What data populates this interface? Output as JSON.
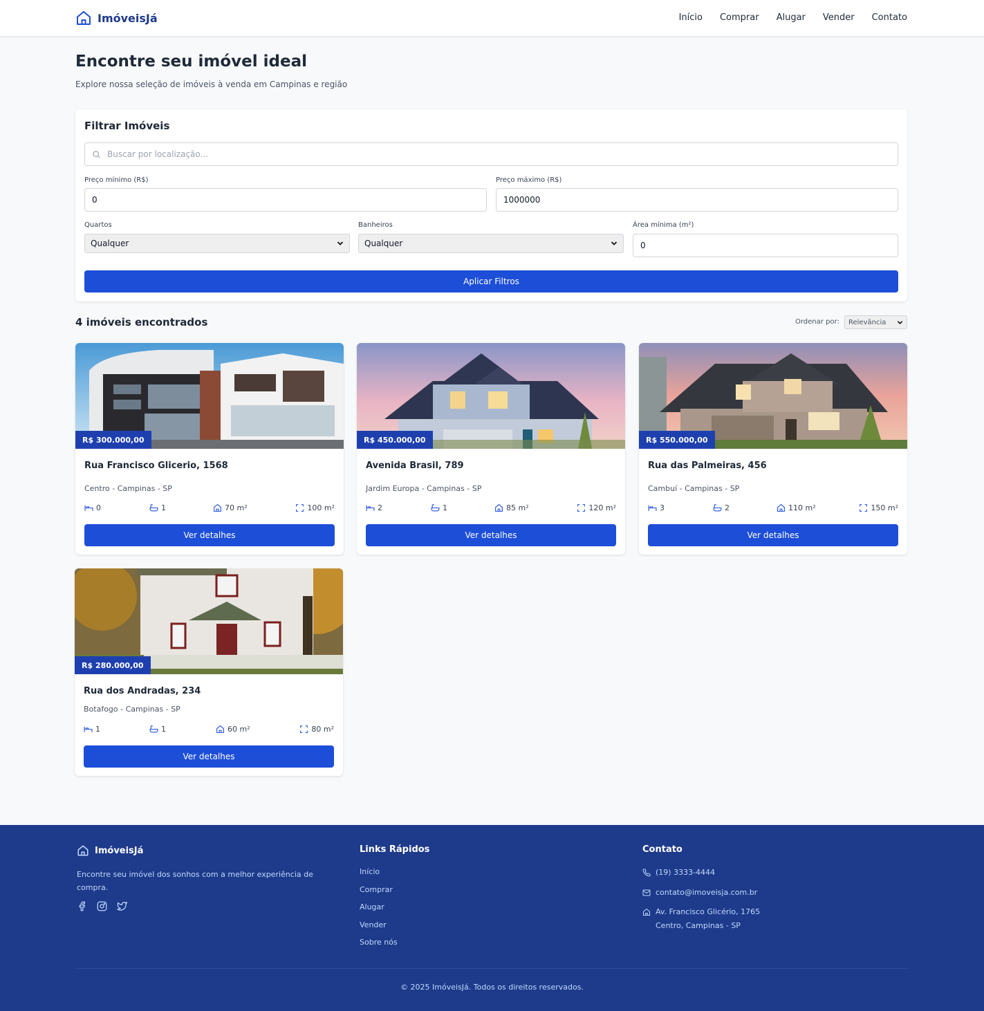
{
  "header": {
    "brand": "ImóveisJá",
    "nav": [
      "Início",
      "Comprar",
      "Alugar",
      "Vender",
      "Contato"
    ]
  },
  "hero": {
    "title": "Encontre seu imóvel ideal",
    "subtitle": "Explore nossa seleção de imóveis à venda em Campinas e região"
  },
  "filters": {
    "title": "Filtrar Imóveis",
    "search_placeholder": "Buscar por localização...",
    "min_price_label": "Preço mínimo (R$)",
    "min_price_value": "0",
    "max_price_label": "Preço máximo (R$)",
    "max_price_value": "1000000",
    "bedrooms_label": "Quartos",
    "bedrooms_value": "Qualquer",
    "bathrooms_label": "Banheiros",
    "bathrooms_value": "Qualquer",
    "min_area_label": "Área mínima (m²)",
    "min_area_value": "0",
    "apply_label": "Aplicar Filtros"
  },
  "results": {
    "count_text": "4 imóveis encontrados",
    "sort_label": "Ordenar por:",
    "sort_value": "Relevância"
  },
  "properties": [
    {
      "price": "R$ 300.000,00",
      "title": "Rua Francisco Glicerio, 1568",
      "location": "Centro - Campinas - SP",
      "bedrooms": "0",
      "bathrooms": "1",
      "built_area": "70 m²",
      "total_area": "100 m²",
      "button": "Ver detalhes"
    },
    {
      "price": "R$ 450.000,00",
      "title": "Avenida Brasil, 789",
      "location": "Jardim Europa - Campinas - SP",
      "bedrooms": "2",
      "bathrooms": "1",
      "built_area": "85 m²",
      "total_area": "120 m²",
      "button": "Ver detalhes"
    },
    {
      "price": "R$ 550.000,00",
      "title": "Rua das Palmeiras, 456",
      "location": "Cambuí - Campinas - SP",
      "bedrooms": "3",
      "bathrooms": "2",
      "built_area": "110 m²",
      "total_area": "150 m²",
      "button": "Ver detalhes"
    },
    {
      "price": "R$ 280.000,00",
      "title": "Rua dos Andradas, 234",
      "location": "Botafogo - Campinas - SP",
      "bedrooms": "1",
      "bathrooms": "1",
      "built_area": "60 m²",
      "total_area": "80 m²",
      "button": "Ver detalhes"
    }
  ],
  "footer": {
    "brand": "ImóveisJá",
    "description": "Encontre seu imóvel dos sonhos com a melhor experiência de compra.",
    "social_icons": [
      "facebook-icon",
      "instagram-icon",
      "twitter-icon"
    ],
    "links_title": "Links Rápidos",
    "links": [
      "Início",
      "Comprar",
      "Alugar",
      "Vender",
      "Sobre nós"
    ],
    "contact_title": "Contato",
    "phone": "(19) 3333-4444",
    "email": "contato@imoveisja.com.br",
    "address_line1": "Av. Francisco Glicério, 1765",
    "address_line2": "Centro, Campinas - SP",
    "copyright": "© 2025 ImóveisJá. Todos os direitos reservados."
  },
  "colors": {
    "primary": "#1d4ed8",
    "brand_dark": "#1e3a8a",
    "badge": "#1e40af",
    "background": "#f7f9fb"
  }
}
